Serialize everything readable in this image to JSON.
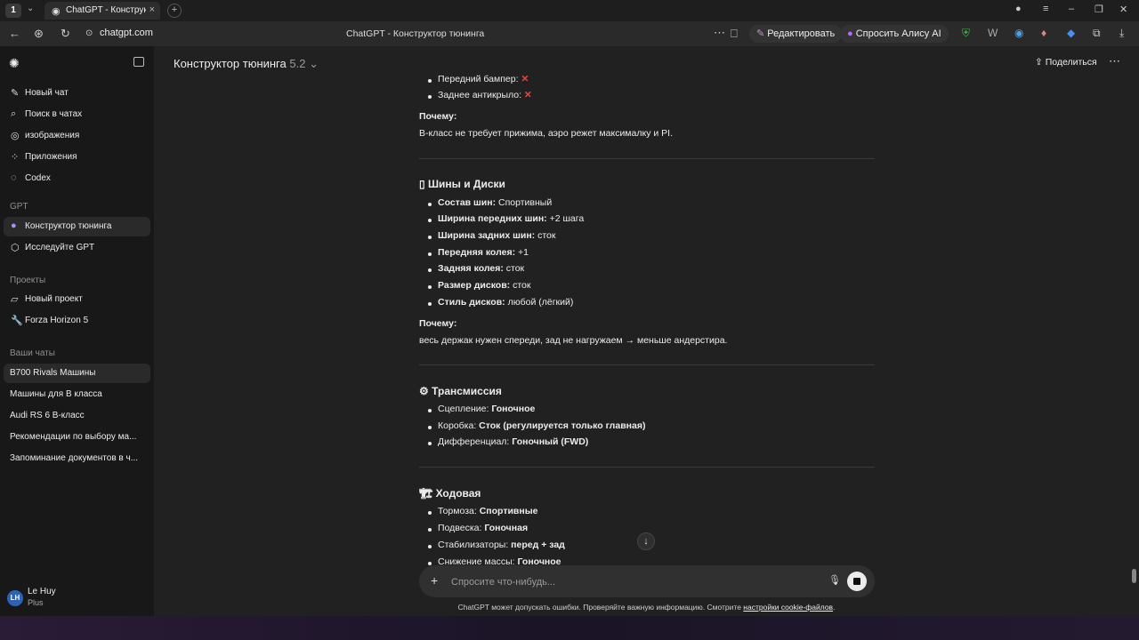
{
  "browser": {
    "tab_title": "ChatGPT - Конструктор т",
    "url": "chatgpt.com",
    "page_title": "ChatGPT - Конструктор тюнинга",
    "edit_btn": "Редактировать",
    "alice_btn": "Спросить Алису AI",
    "workspace": "1"
  },
  "sidebar": {
    "items": [
      "Новый чат",
      "Поиск в чатах",
      "изображения",
      "Приложения",
      "Codex"
    ],
    "gpt_header": "GPT",
    "gpts": [
      "Конструктор тюнинга",
      "Исследуйте GPT"
    ],
    "projects_header": "Проекты",
    "projects": [
      "Новый проект",
      "Forza Horizon 5"
    ],
    "chats_header": "Ваши чаты",
    "chats": [
      "B700 Rivals Машины",
      "Машины для В класса",
      "Audi RS 6 В-класс",
      "Рекомендации по выбору ма...",
      "Запоминание документов в ч..."
    ],
    "user_name": "Le Huy",
    "user_plan": "Plus",
    "user_initials": "LH"
  },
  "header": {
    "model": "Конструктор тюнинга",
    "version": "5.2",
    "share": "Поделиться"
  },
  "content": {
    "aero_items": [
      {
        "label": "Передний бампер:",
        "mark": "✕"
      },
      {
        "label": "Заднее антикрыло:",
        "mark": "✕"
      }
    ],
    "why_label": "Почему:",
    "aero_why": "B-класс не требует прижима, аэро режет максималку и PI.",
    "tires_title": "Шины и Диски",
    "tires_icon": "▯",
    "tires_items": [
      {
        "k": "Состав шин:",
        "v": " Спортивный"
      },
      {
        "k": "Ширина передних шин:",
        "v": " +2 шага"
      },
      {
        "k": "Ширина задних шин:",
        "v": " сток"
      },
      {
        "k": "Передняя колея:",
        "v": " +1"
      },
      {
        "k": "Задняя колея:",
        "v": " сток"
      },
      {
        "k": "Размер дисков:",
        "v": " сток"
      },
      {
        "k": "Стиль дисков:",
        "v": " любой (лёгкий)"
      }
    ],
    "tires_why": "весь держак нужен спереди, зад не нагружаем → меньше андерстира.",
    "trans_title": "Трансмиссия",
    "trans_icon": "⚙",
    "trans_items": [
      {
        "k": "Сцепление: ",
        "v": "Гоночное"
      },
      {
        "k": "Коробка: ",
        "v": "Сток (регулируется только главная)"
      },
      {
        "k": "Дифференциал: ",
        "v": "Гоночный (FWD)"
      }
    ],
    "chassis_title": "Ходовая",
    "chassis_icon": "🏗",
    "chassis_items": [
      {
        "k": "Тормоза: ",
        "v": "Спортивные"
      },
      {
        "k": "Подвеска: ",
        "v": "Гоночная"
      },
      {
        "k": "Стабилизаторы: ",
        "v": "перед + зад"
      },
      {
        "k": "Снижение массы: ",
        "v": "Гоночное"
      }
    ]
  },
  "composer": {
    "placeholder": "Спросите что-нибудь..."
  },
  "footer": {
    "disclaimer": "ChatGPT может допускать ошибки. Проверяйте важную информацию. Смотрите ",
    "link": "настройки cookie-файлов",
    "end": "."
  }
}
